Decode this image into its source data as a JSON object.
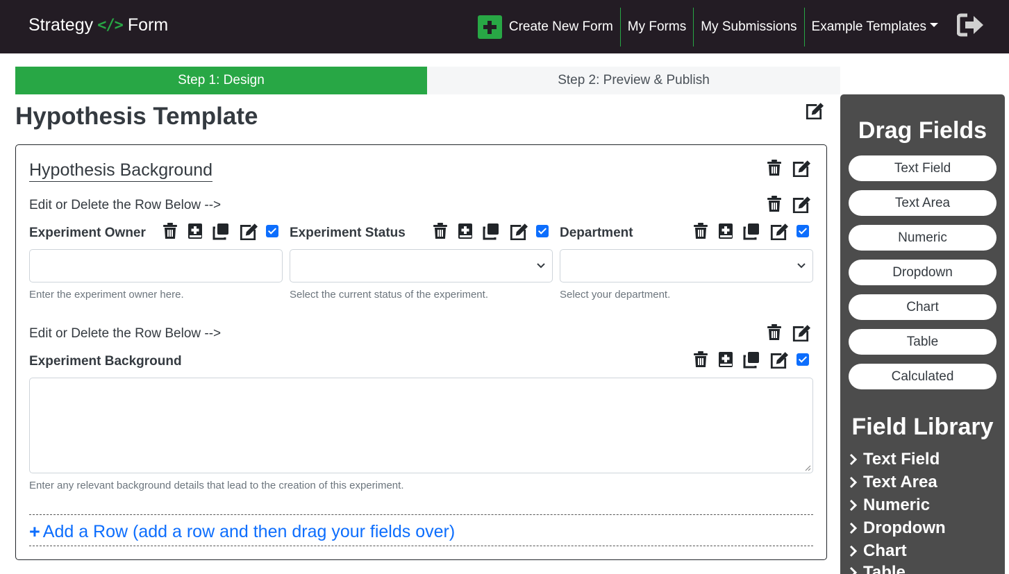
{
  "navbar": {
    "brand_left": "Strategy",
    "brand_code": "</>",
    "brand_right": "Form",
    "create_new": "Create New Form",
    "my_forms": "My Forms",
    "my_submissions": "My Submissions",
    "example_templates": "Example Templates",
    "accent_color": "#28a745"
  },
  "steps": {
    "step1": "Step 1: Design",
    "step2": "Step 2: Preview & Publish"
  },
  "form": {
    "title": "Hypothesis Template",
    "section_title": "Hypothesis Background",
    "rows": [
      {
        "label": "Edit or Delete the Row Below -->",
        "fields": [
          {
            "label": "Experiment Owner",
            "help": "Enter the experiment owner here.",
            "value": ""
          },
          {
            "label": "Experiment Status",
            "help": "Select the current status of the experiment.",
            "value": ""
          },
          {
            "label": "Department",
            "help": "Select your department.",
            "value": ""
          }
        ]
      },
      {
        "label": "Edit or Delete the Row Below -->",
        "fields": [
          {
            "label": "Experiment Background",
            "help": "Enter any relevant background details that lead to the creation of this experiment.",
            "value": ""
          }
        ]
      }
    ],
    "add_row_plus": "+",
    "add_row": "Add a Row (add a row and then drag your fields over)"
  },
  "sidebar": {
    "drag_heading": "Drag Fields",
    "drag_fields": [
      "Text Field",
      "Text Area",
      "Numeric",
      "Dropdown",
      "Chart",
      "Table",
      "Calculated"
    ],
    "library_heading": "Field Library",
    "library_items": [
      "Text Field",
      "Text Area",
      "Numeric",
      "Dropdown",
      "Chart",
      "Table"
    ]
  }
}
